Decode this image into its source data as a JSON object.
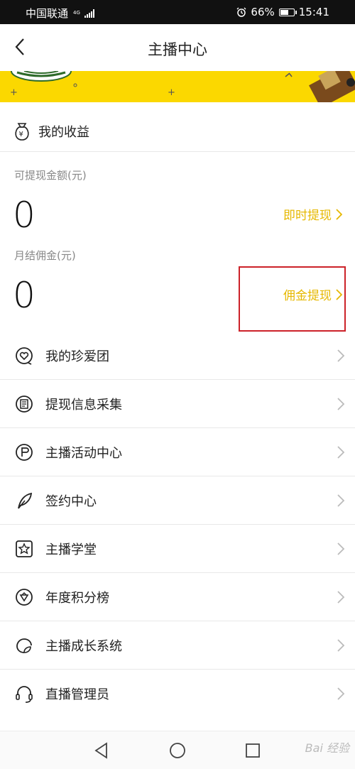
{
  "status_bar": {
    "carrier": "中国联通",
    "network": "4G",
    "alarm_icon": "alarm-icon",
    "battery": "66%",
    "battery_level": 0.66,
    "time": "15:41"
  },
  "header": {
    "title": "主播中心",
    "back_icon": "chevron-left-icon"
  },
  "banner": {
    "color": "#fbd800"
  },
  "earnings": {
    "title": "我的收益",
    "icon": "money-bag-icon",
    "withdrawable_label": "可提现金额(元)",
    "withdrawable_value": "0",
    "instant_withdraw": "即时提现",
    "monthly_label": "月结佣金(元)",
    "monthly_value": "0",
    "commission_withdraw": "佣金提现"
  },
  "menu": [
    {
      "label": "我的珍爱团",
      "icon": "heart-circle-icon"
    },
    {
      "label": "提现信息采集",
      "icon": "document-icon"
    },
    {
      "label": "主播活动中心",
      "icon": "flag-circle-icon"
    },
    {
      "label": "签约中心",
      "icon": "feather-icon"
    },
    {
      "label": "主播学堂",
      "icon": "star-square-icon"
    },
    {
      "label": "年度积分榜",
      "icon": "ranking-badge-icon"
    },
    {
      "label": "主播成长系统",
      "icon": "growth-icon"
    },
    {
      "label": "直播管理员",
      "icon": "headset-icon"
    }
  ],
  "colors": {
    "accent": "#e6b800",
    "highlight": "#cc2229",
    "banner": "#fbd800"
  },
  "watermark": "Bai 经验"
}
